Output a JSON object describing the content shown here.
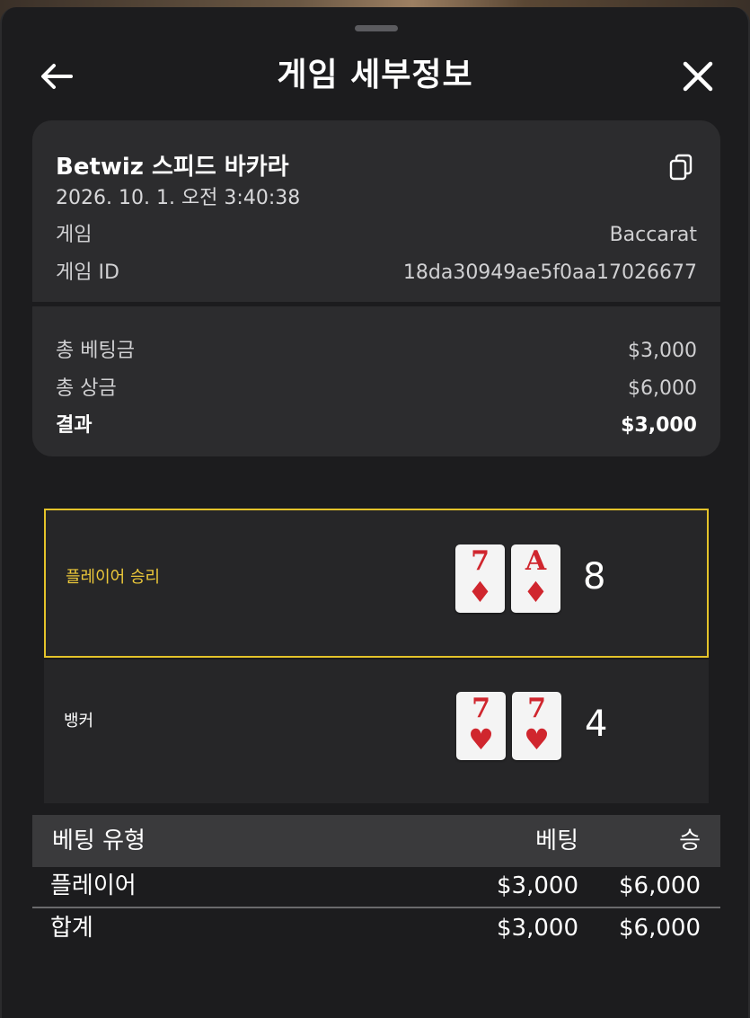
{
  "header": {
    "title": "게임 세부정보"
  },
  "summary": {
    "game_name": "Betwiz 스피드 바카라",
    "timestamp": "2026. 10. 1. 오전 3:40:38",
    "game_label": "게임",
    "game_value": "Baccarat",
    "game_id_label": "게임 ID",
    "game_id_value": "18da30949ae5f0aa17026677",
    "total_bet_label": "총 베팅금",
    "total_bet_value": "$3,000",
    "total_prize_label": "총 상금",
    "total_prize_value": "$6,000",
    "result_label": "결과",
    "result_value": "$3,000"
  },
  "hands": {
    "player": {
      "label": "플레이어 승리",
      "cards": [
        {
          "rank": "7",
          "suit": "♦",
          "suit_name": "diamond"
        },
        {
          "rank": "A",
          "suit": "♦",
          "suit_name": "diamond"
        }
      ],
      "score": "8",
      "winner": true,
      "highlight_color": "#e4c32a"
    },
    "banker": {
      "label": "뱅커",
      "cards": [
        {
          "rank": "7",
          "suit": "♥",
          "suit_name": "heart"
        },
        {
          "rank": "7",
          "suit": "♥",
          "suit_name": "heart"
        }
      ],
      "score": "4",
      "winner": false
    }
  },
  "bets_table": {
    "headers": {
      "type": "베팅 유형",
      "bet": "베팅",
      "win": "승"
    },
    "rows": [
      {
        "type": "플레이어",
        "bet": "$3,000",
        "win": "$6,000"
      }
    ],
    "total": {
      "type": "합계",
      "bet": "$3,000",
      "win": "$6,000"
    }
  },
  "icons": {
    "back": "arrow-left-icon",
    "close": "close-icon",
    "copy": "copy-icon"
  },
  "colors": {
    "accent": "#e4c32a",
    "card_red": "#d0262e",
    "background": "#1c1c1e",
    "panel": "#2c2c2e"
  }
}
